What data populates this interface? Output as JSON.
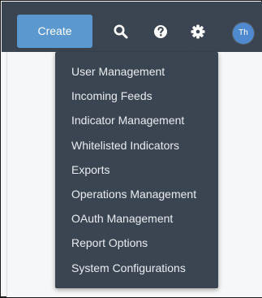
{
  "navbar": {
    "create_label": "Create",
    "icons": {
      "search": "search-icon",
      "help": "question-circle-icon",
      "settings": "gear-icon"
    },
    "avatar_initials": "Th"
  },
  "settings_menu": {
    "items": [
      {
        "label": "User Management"
      },
      {
        "label": "Incoming Feeds"
      },
      {
        "label": "Indicator Management"
      },
      {
        "label": "Whitelisted Indicators"
      },
      {
        "label": "Exports"
      },
      {
        "label": "Operations Management"
      },
      {
        "label": "OAuth Management"
      },
      {
        "label": "Report Options"
      },
      {
        "label": "System Configurations"
      }
    ]
  },
  "colors": {
    "navbar_bg": "#3b4551",
    "create_button_bg": "#5a98cf",
    "avatar_bg": "#4f8ad0",
    "menu_text": "#e9edf1"
  }
}
